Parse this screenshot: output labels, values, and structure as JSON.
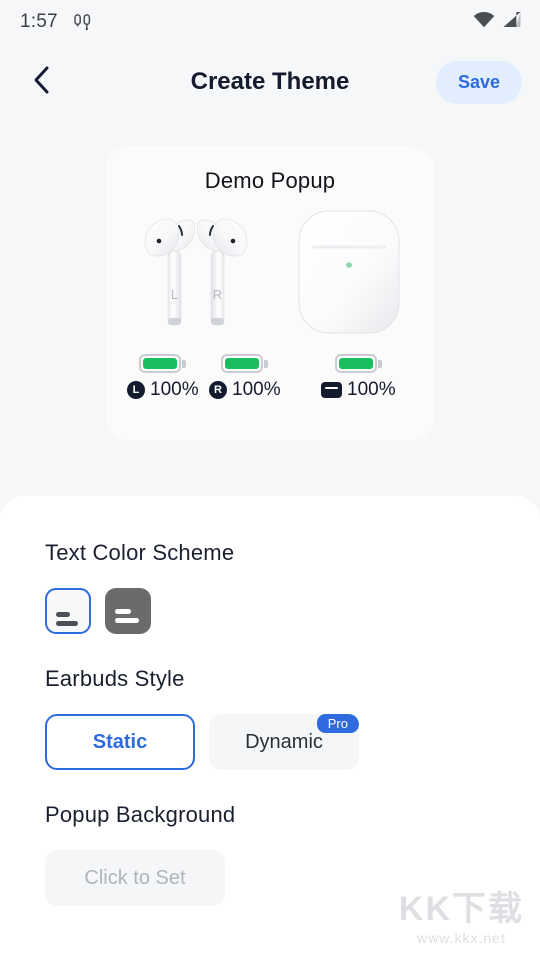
{
  "status_bar": {
    "time": "1:57",
    "left_icons": [
      "earbuds-icon"
    ],
    "right_icons": [
      "wifi-icon",
      "cellular-signal-icon"
    ]
  },
  "app_bar": {
    "back_icon": "chevron-left-icon",
    "title": "Create Theme",
    "save_label": "Save",
    "save_bg_color": "#e2edfd",
    "save_text_color": "#2f6bdd"
  },
  "demo_popup": {
    "title": "Demo Popup",
    "earbud_left_label": "L",
    "earbud_right_label": "R",
    "batteries": [
      {
        "badge": "L",
        "badge_type": "circle",
        "value": "100%",
        "level": 100
      },
      {
        "badge": "R",
        "badge_type": "circle",
        "value": "100%",
        "level": 100
      },
      {
        "badge": "",
        "badge_type": "case",
        "value": "100%",
        "level": 100
      }
    ],
    "battery_fill_color": "#19bf5e",
    "case_led_color": "#8fd6a8"
  },
  "sections": {
    "text_color_scheme": {
      "title": "Text Color Scheme",
      "options": [
        {
          "name": "light-scheme-swatch",
          "selected": true
        },
        {
          "name": "dark-scheme-swatch",
          "selected": false
        }
      ],
      "selected_border_color": "#2f6bdd"
    },
    "earbuds_style": {
      "title": "Earbuds Style",
      "options": [
        {
          "label": "Static",
          "selected": true,
          "badge": ""
        },
        {
          "label": "Dynamic",
          "selected": false,
          "badge": "Pro"
        }
      ],
      "badge_color": "#2f6bdd"
    },
    "popup_background": {
      "title": "Popup Background",
      "button_label": "Click to Set"
    }
  },
  "watermark": {
    "main": "KK下载",
    "sub": "www.kkx.net"
  }
}
